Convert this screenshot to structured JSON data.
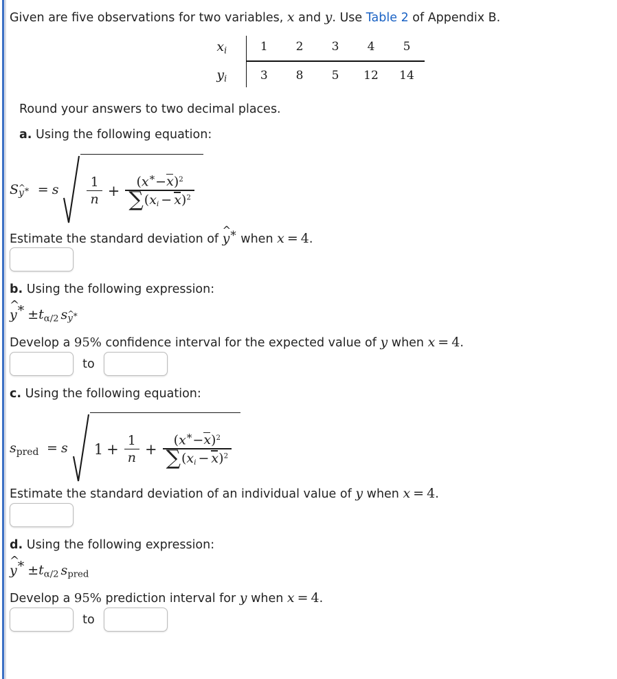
{
  "accent": {
    "rule_blue": "#3b6fc4",
    "link_blue": "#1a62c4",
    "text": "#232323"
  },
  "intro": {
    "before_link": "Given are five observations for two variables, ",
    "var_x": "x",
    "conjunction": " and ",
    "var_y": "y",
    "after_vars": ". Use ",
    "link_label": "Table 2",
    "after_link": " of Appendix B."
  },
  "data_table": {
    "x_label": "x",
    "x_label_sub": "i",
    "y_label": "y",
    "y_label_sub": "i",
    "x_values": [
      "1",
      "2",
      "3",
      "4",
      "5"
    ],
    "y_values": [
      "3",
      "8",
      "5",
      "12",
      "14"
    ]
  },
  "rounding_note": "Round your answers to two decimal places.",
  "parts": {
    "a": {
      "marker": "a.",
      "intro": "Using the following equation:",
      "formula_lhs_S": "S",
      "formula_lhs_yhat": "y",
      "formula_lhs_star": "*",
      "formula_eq": "=",
      "formula_s": "s",
      "numer_one": "1",
      "denom_n": "n",
      "plus": "+",
      "frac_numer": "(x * − x̄)²",
      "frac_denom": "Σ (x i − x̄)²",
      "question_pre": "Estimate the standard deviation of ",
      "question_yhat": "y",
      "question_star": "*",
      "question_mid": " when ",
      "question_x": "x",
      "question_eq": "=",
      "question_val": "4",
      "question_end": ".",
      "answer_value": "",
      "answer_placeholder": ""
    },
    "b": {
      "marker": "b.",
      "intro": "Using the following expression:",
      "expr_yhat": "y",
      "expr_star": "*",
      "expr_pm": "±",
      "expr_t": "t",
      "expr_t_sub": "α/2",
      "expr_s": "s",
      "expr_s_sub_yhat": "y",
      "expr_s_sub_star": "*",
      "question_pre": "Develop a ",
      "question_level": "95%",
      "question_mid": " confidence interval for the expected value of ",
      "question_y": "y",
      "question_when": " when ",
      "question_x": "x",
      "question_eq": "=",
      "question_val": "4",
      "question_end": ".",
      "lower_value": "",
      "to_label": "to",
      "upper_value": ""
    },
    "c": {
      "marker": "c.",
      "intro": "Using the following equation:",
      "formula_lhs_s": "s",
      "formula_lhs_sub": "pred",
      "formula_eq": "=",
      "formula_s": "s",
      "lead_one": "1",
      "plus1": "+",
      "numer_one": "1",
      "denom_n": "n",
      "plus2": "+",
      "frac_numer": "(x * − x̄)²",
      "frac_denom": "Σ (x i − x̄)²",
      "question_pre": "Estimate the standard deviation of an individual value of ",
      "question_y": "y",
      "question_when": " when ",
      "question_x": "x",
      "question_eq": "=",
      "question_val": "4",
      "question_end": ".",
      "answer_value": ""
    },
    "d": {
      "marker": "d.",
      "intro": "Using the following expression:",
      "expr_yhat": "y",
      "expr_star": "*",
      "expr_pm": "±",
      "expr_t": "t",
      "expr_t_sub": "α/2",
      "expr_s": "s",
      "expr_s_sub": "pred",
      "question_pre": "Develop a ",
      "question_level": "95%",
      "question_mid": " prediction interval for ",
      "question_y": "y",
      "question_when": " when ",
      "question_x": "x",
      "question_eq": "=",
      "question_val": "4",
      "question_end": ".",
      "lower_value": "",
      "to_label": "to",
      "upper_value": ""
    }
  },
  "symbols": {
    "hat": "^",
    "star": "*",
    "sum": "Σ",
    "minus": "−",
    "plus": "+",
    "equals": "=",
    "plusminus": "±",
    "alpha_half": "α/2",
    "squared": "2",
    "sub_i": "i",
    "pred": "pred",
    "n": "n",
    "one": "1",
    "x": "x",
    "y": "y",
    "s": "s",
    "S": "S",
    "t": "t",
    "paren_open": "(",
    "paren_close": ")"
  }
}
